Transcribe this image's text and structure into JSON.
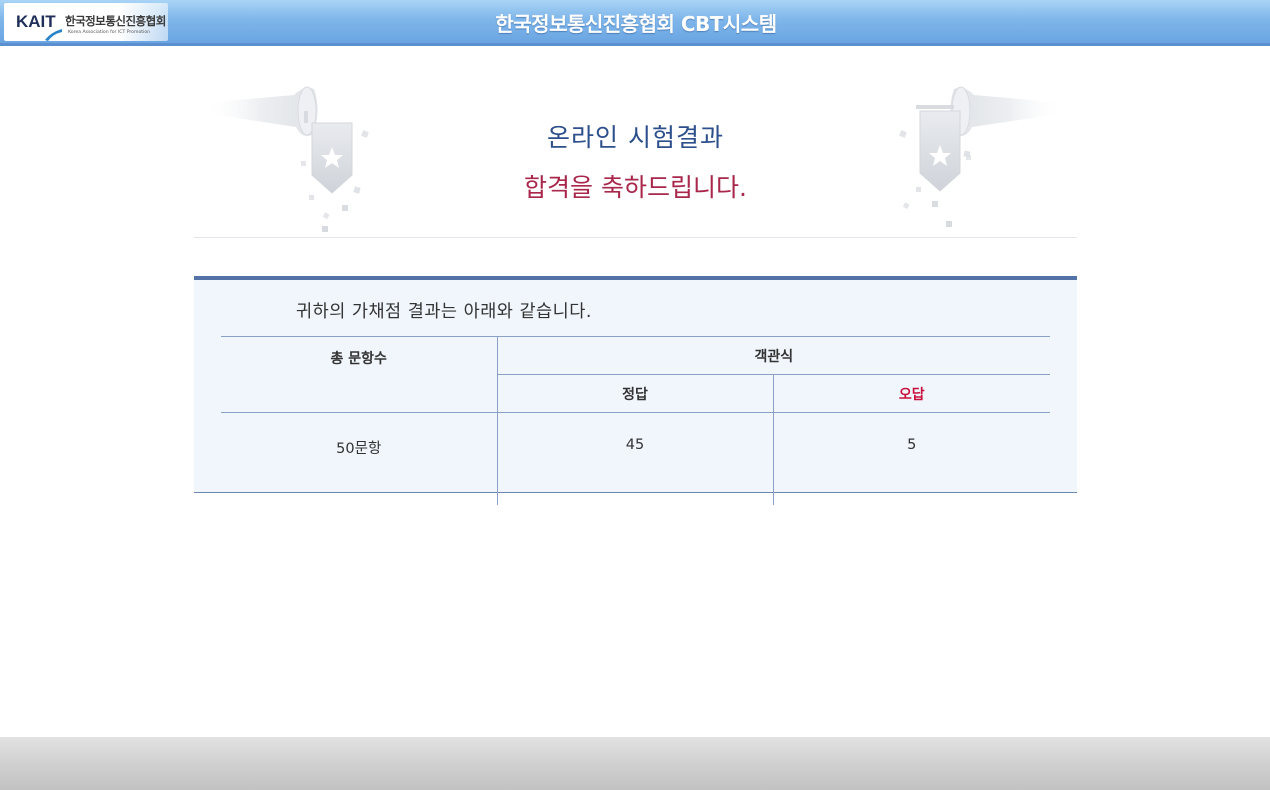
{
  "header": {
    "logo": {
      "kait": "KAIT",
      "korean_name": "한국정보통신진흥협회",
      "english_name": "Korea Association for ICT Promotion"
    },
    "title": "한국정보통신진흥협회 CBT시스템",
    "colors": {
      "bar": "#7fb6ea",
      "title_text": "#ffffff"
    }
  },
  "banner": {
    "title": "온라인 시험결과",
    "message": "합격을 축하드립니다.",
    "colors": {
      "title": "#2d4f8c",
      "message": "#a8274a"
    },
    "decorations": [
      "trumpet-left-icon",
      "trumpet-right-icon"
    ]
  },
  "result": {
    "intro": "귀하의 가채점 결과는 아래와 같습니다.",
    "table": {
      "headers": {
        "total": "총 문항수",
        "objective": "객관식",
        "correct": "정답",
        "wrong": "오답"
      },
      "row": {
        "total": "50문항",
        "correct": "45",
        "wrong": "5"
      }
    },
    "colors": {
      "wrong_header": "#c8103c",
      "panel_bg": "#f1f6fc",
      "panel_border": "#5373a7"
    }
  }
}
